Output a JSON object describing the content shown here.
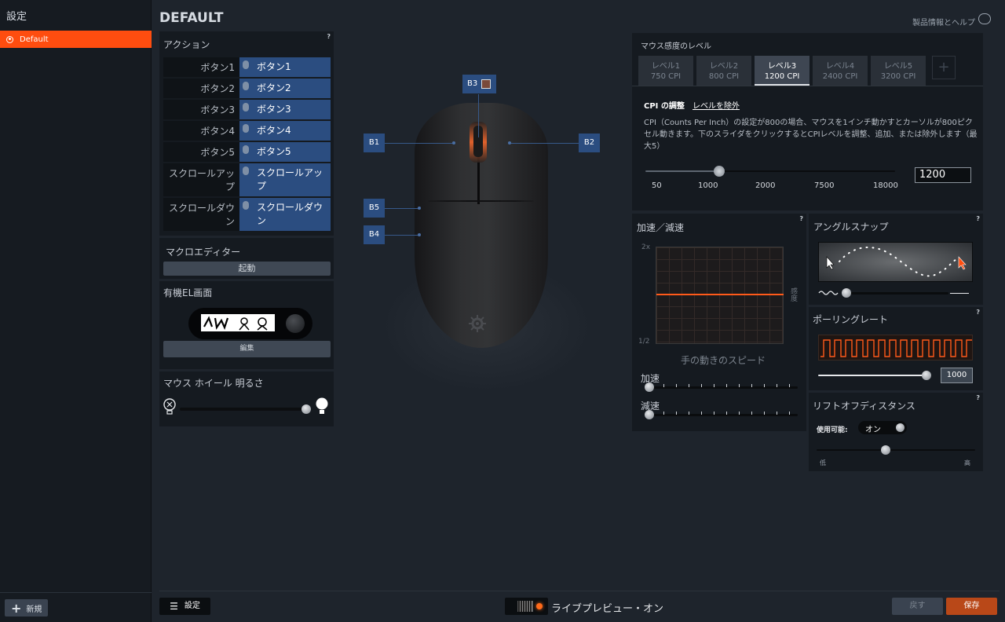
{
  "sidebar": {
    "title": "設定",
    "profile": "Default",
    "new_label": "新規"
  },
  "header": {
    "title": "DEFAULT",
    "help": "製品情報とヘルプ"
  },
  "actions": {
    "title": "アクション",
    "rows": [
      {
        "key": "ボタン1",
        "val": "ボタン1"
      },
      {
        "key": "ボタン2",
        "val": "ボタン2"
      },
      {
        "key": "ボタン3",
        "val": "ボタン3"
      },
      {
        "key": "ボタン4",
        "val": "ボタン4"
      },
      {
        "key": "ボタン5",
        "val": "ボタン5"
      },
      {
        "key": "スクロールアップ",
        "val": "スクロールアップ"
      },
      {
        "key": "スクロールダウン",
        "val": "スクロールダウン"
      }
    ]
  },
  "macro": {
    "title": "マクロエディター",
    "button": "起動"
  },
  "oled": {
    "title": "有機EL画面",
    "button": "編集"
  },
  "wheel_light": {
    "title": "マウス ホイール 明るさ",
    "level": 0.97
  },
  "mouse_labels": {
    "b1": "B1",
    "b2": "B2",
    "b3": "B3",
    "b4": "B4",
    "b5": "B5"
  },
  "cpi": {
    "title": "マウス感度のレベル",
    "levels": [
      {
        "name": "レベル1",
        "value": "750 CPI"
      },
      {
        "name": "レベル2",
        "value": "800 CPI"
      },
      {
        "name": "レベル3",
        "value": "1200 CPI"
      },
      {
        "name": "レベル4",
        "value": "2400 CPI"
      },
      {
        "name": "レベル5",
        "value": "3200 CPI"
      }
    ],
    "add": "+",
    "adjust_tab": "CPI の調整",
    "remove_tab": "レベルを除外",
    "description": "CPI（Counts Per Inch）の設定が800の場合、マウスを1インチ動かすとカーソルが800ピクセル動きます。下のスライダをクリックするとCPIレベルを調整、追加、または除外します（最大5）",
    "scale": [
      "50",
      "1000",
      "2000",
      "7500",
      "18000"
    ],
    "input_value": "1200"
  },
  "accel": {
    "title": "加速／減速",
    "y_top": "2x",
    "y_bottom": "1/2",
    "y_label": "感度",
    "x_label": "手の動きのスピード",
    "accel_label": "加速",
    "decel_label": "減速"
  },
  "angle_snap": {
    "title": "アングルスナップ"
  },
  "polling": {
    "title": "ポーリングレート",
    "value": "1000"
  },
  "lift_off": {
    "title": "リフトオフディスタンス",
    "enable_label": "使用可能:",
    "toggle": "オン",
    "low": "低",
    "high": "高"
  },
  "footer": {
    "settings": "設定",
    "live_preview": "ライブプレビュー・オン",
    "back": "戻す",
    "save": "保存"
  },
  "help_q": "?"
}
